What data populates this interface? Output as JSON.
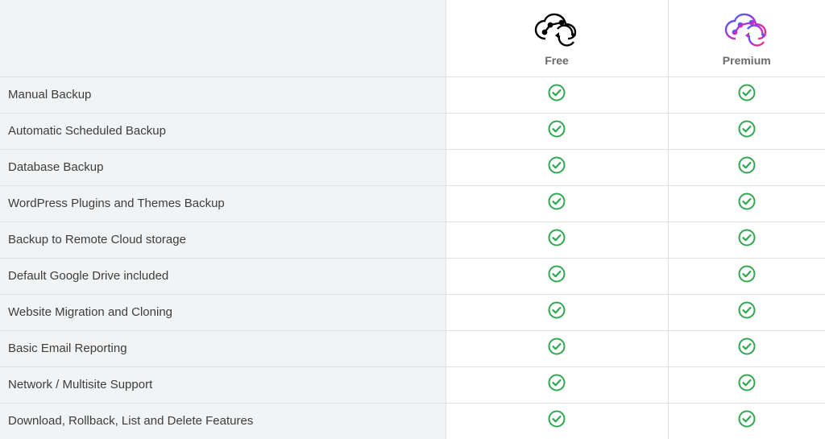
{
  "plans": {
    "free": {
      "label": "Free"
    },
    "premium": {
      "label": "Premium"
    }
  },
  "features": [
    {
      "name": "Manual Backup",
      "free": true,
      "premium": true
    },
    {
      "name": "Automatic Scheduled Backup",
      "free": true,
      "premium": true
    },
    {
      "name": "Database Backup",
      "free": true,
      "premium": true
    },
    {
      "name": "WordPress Plugins and Themes Backup",
      "free": true,
      "premium": true
    },
    {
      "name": "Backup to Remote Cloud storage",
      "free": true,
      "premium": true
    },
    {
      "name": "Default Google Drive included",
      "free": true,
      "premium": true
    },
    {
      "name": "Website Migration and Cloning",
      "free": true,
      "premium": true
    },
    {
      "name": "Basic Email Reporting",
      "free": true,
      "premium": true
    },
    {
      "name": "Network / Multisite Support",
      "free": true,
      "premium": true
    },
    {
      "name": "Download, Rollback, List and Delete Features",
      "free": true,
      "premium": true
    }
  ]
}
